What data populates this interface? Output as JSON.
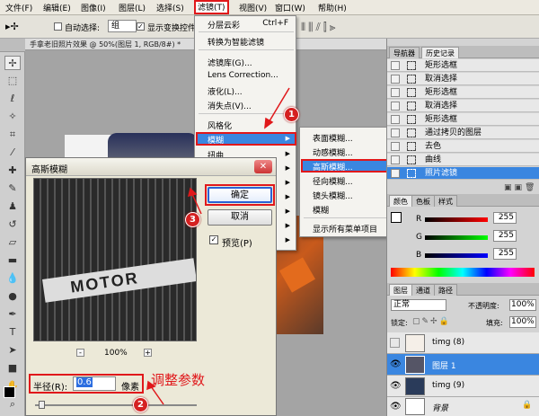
{
  "menubar": {
    "items": [
      "文件(F)",
      "编辑(E)",
      "图像(I)",
      "图层(L)",
      "选择(S)",
      "滤镜(T)",
      "视图(V)",
      "窗口(W)",
      "帮助(H)"
    ]
  },
  "options": {
    "auto_select_label": "自动选择:",
    "auto_select_value": "组",
    "show_transform_label": "显示变换控件"
  },
  "document": {
    "tab_title": "手拿老旧照片效果 @ 50%(图层 1, RGB/8#) *"
  },
  "filter_menu": {
    "items": [
      {
        "label": "分层云彩",
        "shortcut": "Ctrl+F"
      },
      {
        "label": "转换为智能滤镜"
      },
      {
        "label": "滤镜库(G)..."
      },
      {
        "label": "Lens Correction..."
      },
      {
        "label": "液化(L)..."
      },
      {
        "label": "消失点(V)..."
      },
      {
        "label": "风格化"
      },
      {
        "label": "模糊"
      },
      {
        "label": "扭曲"
      }
    ]
  },
  "blur_submenu": {
    "items": [
      "表面模糊...",
      "动感模糊...",
      "高斯模糊...",
      "径向模糊...",
      "镜头模糊...",
      "模糊",
      "特殊模糊...",
      "形状模糊..."
    ],
    "extra": "显示所有菜单项目"
  },
  "dialog": {
    "title": "高斯模糊",
    "ok": "确定",
    "cancel": "取消",
    "preview_label": "预览(P)",
    "zoom": "100%",
    "minus": "-",
    "plus": "+",
    "radius_label": "半径(R):",
    "radius_value": "0.6",
    "unit": "像素"
  },
  "annotations": {
    "n1": "1",
    "n2": "2",
    "n3": "3",
    "adjust_text": "调整参数"
  },
  "history": {
    "tabs": [
      "导航器",
      "历史记录"
    ],
    "rows": [
      "矩形选框",
      "取消选择",
      "矩形选框",
      "取消选择",
      "矩形选框",
      "通过拷贝的图层",
      "去色",
      "曲线",
      "照片滤镜"
    ]
  },
  "color": {
    "tabs": [
      "颜色",
      "色板",
      "样式"
    ],
    "r": "255",
    "g": "255",
    "b": "255",
    "labels": [
      "R",
      "G",
      "B"
    ]
  },
  "layers": {
    "tabs": [
      "图层",
      "通道",
      "路径"
    ],
    "mode": "正常",
    "opacity_label": "不透明度:",
    "opacity": "100%",
    "lock_label": "锁定:",
    "fill_label": "填充:",
    "fill": "100%",
    "rows": [
      "timg (8)",
      "图层 1",
      "timg (9)",
      "背景"
    ]
  },
  "colors": {
    "accent": "#3a86e0",
    "red": "#e0181b"
  }
}
